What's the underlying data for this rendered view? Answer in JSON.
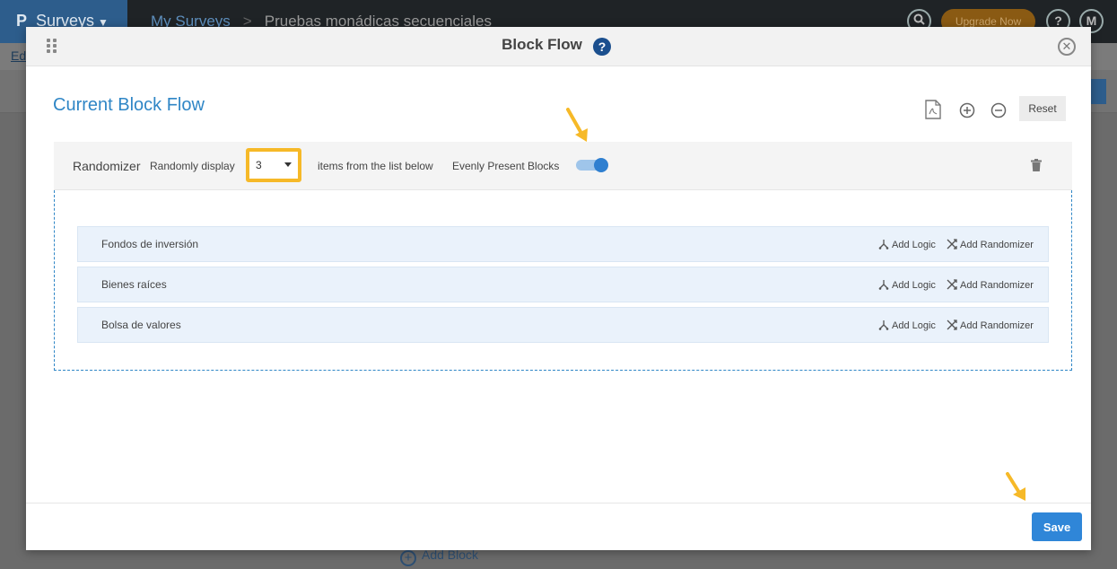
{
  "app": {
    "brand": "Surveys",
    "logo": "P",
    "crumb_root": "My Surveys",
    "crumb_sep": ">",
    "crumb_current": "Pruebas monádicas secuenciales",
    "upgrade": "Upgrade Now",
    "help": "?",
    "avatar": "M",
    "sub_link": "Ed",
    "add_block": "Add Block"
  },
  "modal": {
    "title": "Block Flow",
    "help": "?",
    "section_title": "Current Block Flow",
    "reset_label": "Reset",
    "save_label": "Save"
  },
  "randomizer": {
    "label": "Randomizer",
    "randomly_display": "Randomly display",
    "count": "3",
    "items_text": "items from the list below",
    "evenly_label": "Evenly Present Blocks",
    "evenly_on": true
  },
  "blocks": [
    {
      "name": "Fondos de inversión",
      "add_logic": "Add Logic",
      "add_randomizer": "Add Randomizer"
    },
    {
      "name": "Bienes raíces",
      "add_logic": "Add Logic",
      "add_randomizer": "Add Randomizer"
    },
    {
      "name": "Bolsa de valores",
      "add_logic": "Add Logic",
      "add_randomizer": "Add Randomizer"
    }
  ],
  "colors": {
    "accent": "#2f86c6",
    "highlight": "#f6b928",
    "save": "#2f86d8",
    "toggle": "#2f7fd0"
  },
  "icons": [
    "drag-handle-icon",
    "help-icon",
    "close-icon",
    "pdf-icon",
    "zoom-in-icon",
    "zoom-out-icon",
    "trash-icon",
    "logic-icon",
    "shuffle-icon",
    "arrow-pointer-icon"
  ]
}
